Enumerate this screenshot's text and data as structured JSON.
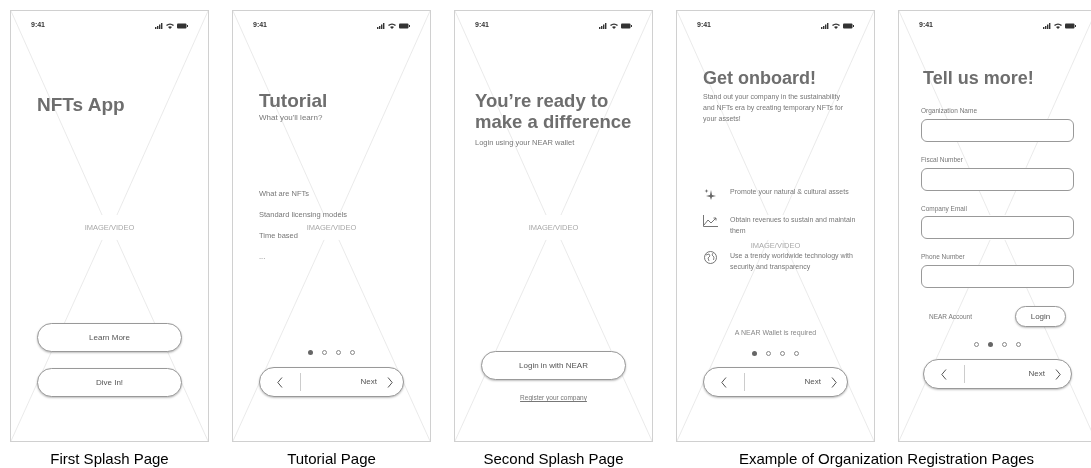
{
  "groups": [
    {
      "caption": "First Splash Page",
      "screens": [
        {
          "kind": "splash",
          "time": "9:41",
          "title": "NFTs App",
          "media_label": "IMAGE/VIDEO",
          "buttons": [
            "Learn More",
            "Dive In!"
          ]
        }
      ]
    },
    {
      "caption": "Tutorial Page",
      "screens": [
        {
          "kind": "tutorial",
          "time": "9:41",
          "title": "Tutorial",
          "subtitle": "What you'll learn?",
          "items": [
            "What are NFTs",
            "Standard licensing models",
            "Time based",
            "..."
          ],
          "media_label": "IMAGE/VIDEO",
          "dots": [
            {
              "selected": true
            },
            {
              "selected": false
            },
            {
              "selected": false
            },
            {
              "selected": false
            }
          ],
          "next": "Next"
        }
      ]
    },
    {
      "caption": "Second Splash Page",
      "screens": [
        {
          "kind": "login",
          "time": "9:41",
          "title": "You’re ready to make a difference",
          "subtitle": "Login using your NEAR wallet",
          "media_label": "IMAGE/VIDEO",
          "button": "Login in with NEAR",
          "link": "Register your company"
        }
      ]
    },
    {
      "caption": "Example of Organization Registration Pages",
      "screens": [
        {
          "kind": "onboard",
          "time": "9:41",
          "title": "Get onboard!",
          "description": "Stand out your company in the sustainability and NFTs era by creating temporary NFTs for your assets!",
          "features": [
            "Promote your natural & cultural assets",
            "Obtain revenues to sustain and maintain them",
            "Use a trendy worldwide technology with security and transparency"
          ],
          "media_label": "IMAGE/VIDEO",
          "note": "A NEAR Wallet is required",
          "dots": [
            {
              "selected": true
            },
            {
              "selected": false
            },
            {
              "selected": false
            },
            {
              "selected": false
            }
          ],
          "next": "Next"
        },
        {
          "kind": "form",
          "time": "9:41",
          "title": "Tell us more!",
          "fields": [
            {
              "label": "Organization Name"
            },
            {
              "label": "Fiscal Number"
            },
            {
              "label": "Company Email"
            },
            {
              "label": "Phone Number"
            }
          ],
          "account_label": "NEAR Account",
          "account_button": "Login",
          "dots": [
            {
              "selected": false
            },
            {
              "selected": true
            },
            {
              "selected": false
            },
            {
              "selected": false
            }
          ],
          "next": "Next"
        }
      ]
    }
  ]
}
